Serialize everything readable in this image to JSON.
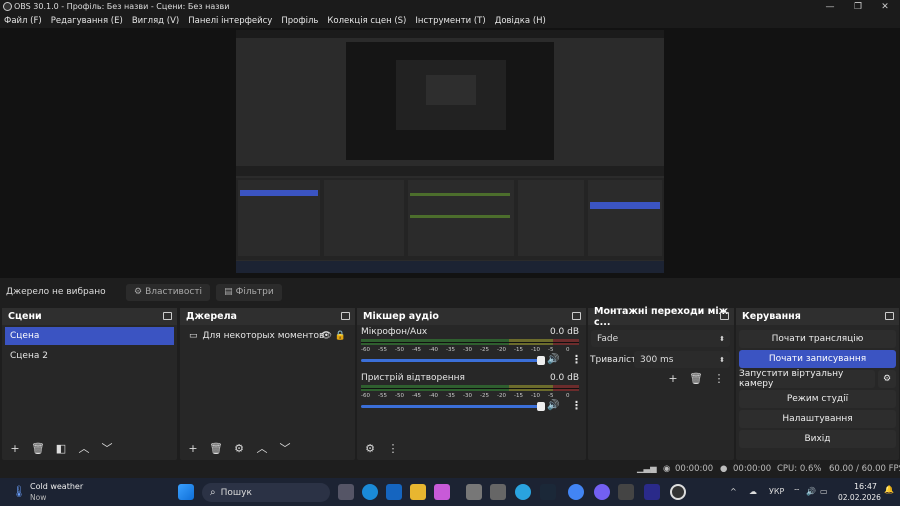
{
  "window": {
    "title": "OBS 30.1.0 - Профіль: Без назви - Сцени: Без назви"
  },
  "menu": [
    "Файл (F)",
    "Редагування (E)",
    "Вигляд (V)",
    "Панелі інтерфейсу",
    "Профіль",
    "Колекція сцен (S)",
    "Інструменти (T)",
    "Довідка (H)"
  ],
  "source_bar": {
    "label": "Джерело не вибрано",
    "properties": "Властивості",
    "filters": "Фільтри"
  },
  "scenes": {
    "title": "Сцени",
    "items": [
      "Сцена",
      "Сцена 2"
    ],
    "selected": 0
  },
  "sources": {
    "title": "Джерела",
    "items": [
      "Для некоторых моментов"
    ]
  },
  "mixer": {
    "title": "Мікшер аудіо",
    "ticks": [
      "-60",
      "-55",
      "-50",
      "-45",
      "-40",
      "-35",
      "-30",
      "-25",
      "-20",
      "-15",
      "-10",
      "-5",
      "0"
    ],
    "channels": [
      {
        "name": "Мікрофон/Aux",
        "db": "0.0 dB"
      },
      {
        "name": "Пристрій відтворення",
        "db": "0.0 dB"
      }
    ]
  },
  "transitions": {
    "title": "Монтажні переходи між с...",
    "type": "Fade",
    "duration_label": "Тривалість",
    "duration": "300 ms"
  },
  "controls": {
    "title": "Керування",
    "buttons": [
      "Почати трансляцію",
      "Почати записування",
      "Запустити віртуальну камеру",
      "Режим студії",
      "Налаштування",
      "Вихід"
    ],
    "highlighted": 1
  },
  "status": {
    "stream_time": "00:00:00",
    "rec_time": "00:00:00",
    "cpu": "CPU: 0.6%",
    "fps": "60.00 / 60.00 FPS"
  },
  "taskbar": {
    "weather_title": "Cold weather",
    "weather_sub": "Now",
    "search": "Пошук",
    "lang": "УКР",
    "time": "16:47",
    "date": "02.02.2026"
  },
  "colors": {
    "accent": "#3b54c2",
    "dock_bg": "#272727",
    "taskbar": "#1c2333"
  }
}
